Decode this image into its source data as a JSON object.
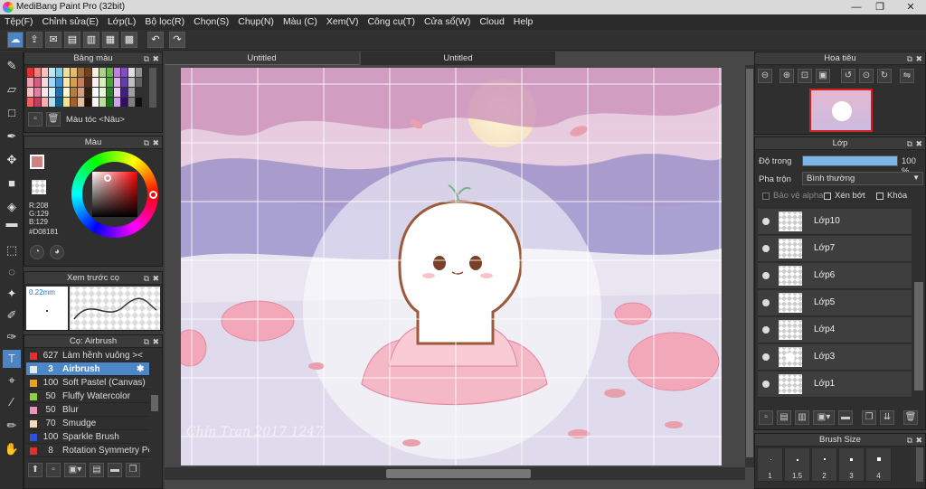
{
  "window": {
    "title": "MediBang Paint Pro (32bit)",
    "minimize": "—",
    "maximize": "❐",
    "close": "✕"
  },
  "menu": [
    "Tệp(F)",
    "Chỉnh sửa(E)",
    "Lớp(L)",
    "Bộ lọc(R)",
    "Chọn(S)",
    "Chụp(N)",
    "Màu (C)",
    "Xem(V)",
    "Công cụ(T)",
    "Cửa sổ(W)",
    "Cloud",
    "Help"
  ],
  "tabs": [
    "Untitled",
    "Untitled"
  ],
  "palette_panel": {
    "title": "Bảng màu",
    "label": "Màu tóc <Nâu>"
  },
  "color_panel": {
    "title": "Màu",
    "r": "R:208",
    "g": "G:129",
    "b": "B:129",
    "hex": "#D08181",
    "primary": "#d08181"
  },
  "preview_panel": {
    "title": "Xem trước cọ",
    "size": "0.22mm"
  },
  "brush_panel": {
    "title": "Cọ: Airbrush",
    "items": [
      {
        "size": "627",
        "name": "Làm hềnh vuông ><",
        "color": "#e03030"
      },
      {
        "size": "3",
        "name": "Airbrush",
        "color": "#e8e8e8",
        "selected": true
      },
      {
        "size": "100",
        "name": "Soft Pastel (Canvas)",
        "color": "#f0a020"
      },
      {
        "size": "50",
        "name": "Fluffy Watercolor",
        "color": "#90d040"
      },
      {
        "size": "50",
        "name": "Blur",
        "color": "#f090c0"
      },
      {
        "size": "70",
        "name": "Smudge",
        "color": "#f8d8b8"
      },
      {
        "size": "100",
        "name": "Sparkle Brush",
        "color": "#3050e0"
      },
      {
        "size": "8",
        "name": "Rotation Symmetry Pen",
        "color": "#e03030"
      }
    ]
  },
  "navigator_panel": {
    "title": "Hoa tiêu"
  },
  "layer_panel": {
    "title": "Lớp",
    "opacity_label": "Độ trong",
    "opacity_value": "100 %",
    "opacity": 1.0,
    "blend_label": "Pha trộn",
    "blend_value": "Bình thường",
    "protect_alpha": "Bảo vệ alpha",
    "clipping": "Xén bớt",
    "lock": "Khóa",
    "layers": [
      "Lớp10",
      "Lớp7",
      "Lớp6",
      "Lớp5",
      "Lớp4",
      "Lớp3",
      "Lớp1"
    ]
  },
  "brush_size_panel": {
    "title": "Brush Size",
    "sizes": [
      "1",
      "1.5",
      "2",
      "3",
      "4"
    ]
  },
  "canvas": {
    "watermark": "Chín Tran 2017 1247"
  }
}
